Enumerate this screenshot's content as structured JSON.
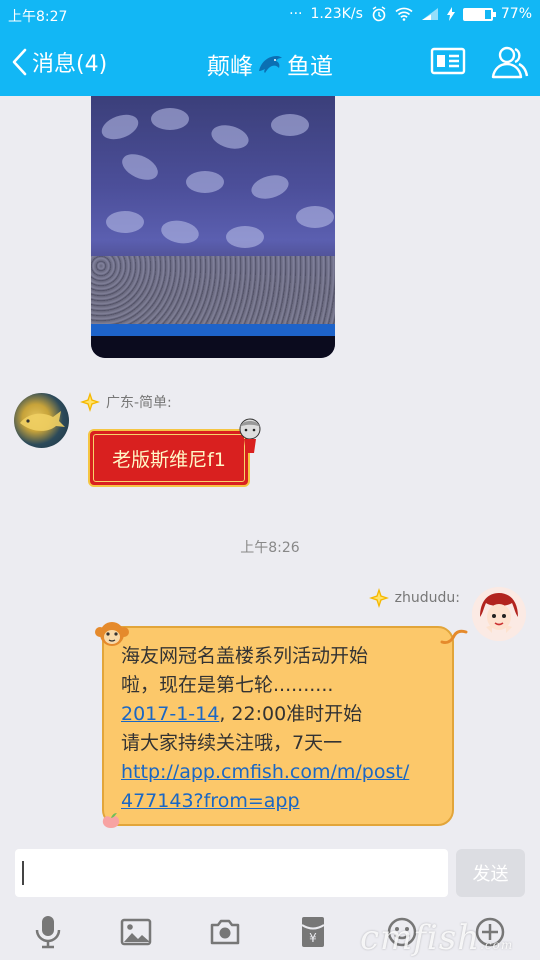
{
  "status_bar": {
    "time": "上午8:27",
    "dots": "···",
    "speed": "1.23K/s",
    "battery_percent": "77%",
    "battery_level": 0.77
  },
  "header": {
    "back_label": "消息(4)",
    "title_left": "颠峰",
    "title_right": "鱼道",
    "color": "#12b7f5"
  },
  "messages": {
    "incoming": {
      "sender": "广东-简单:",
      "text": "老版斯维尼f1"
    },
    "timestamp": "上午8:26",
    "outgoing": {
      "sender": "zhududu:",
      "line1": "海友网冠名盖楼系列活动开始",
      "line2": "啦，现在是第七轮..........",
      "date_link": "2017-1-14",
      "line3_rest": ", 22:00准时开始",
      "line4": "请大家持续关注哦，7天一",
      "url_line1": "http://app.cmfish.com/m/post/",
      "url_line2": "477143?from=app"
    }
  },
  "input": {
    "send_label": "发送"
  },
  "toolbar": {
    "icons": [
      "microphone-icon",
      "image-icon",
      "camera-icon",
      "red-packet-icon",
      "emoji-icon",
      "plus-icon"
    ]
  },
  "watermark": {
    "text": "cmfish",
    "suffix": ".com"
  }
}
